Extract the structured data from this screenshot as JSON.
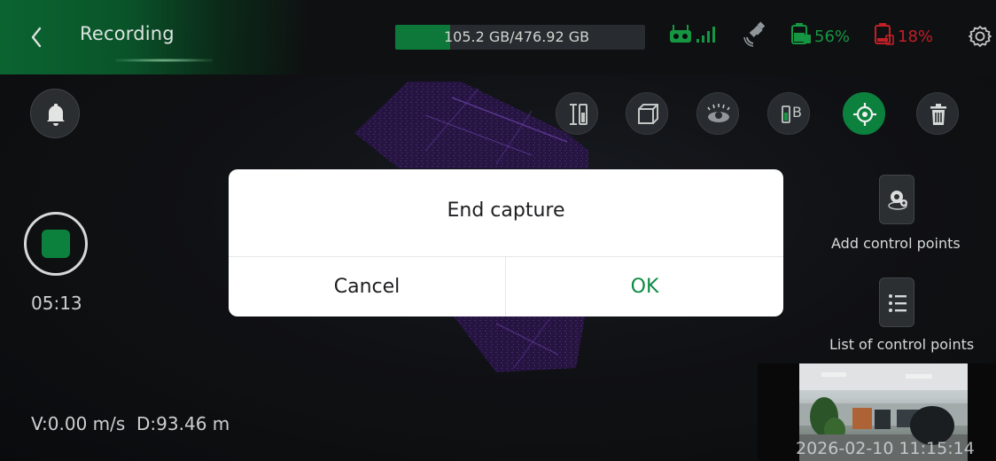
{
  "header": {
    "title": "Recording",
    "storage_text": "105.2 GB/476.92 GB",
    "storage_fraction": 0.22,
    "device_battery": "56%",
    "phone_battery": "18%"
  },
  "left": {
    "timer": "05:13",
    "speed_distance": "V:0.00 m/s  D:93.46 m"
  },
  "toolbar": {
    "b_label": "B"
  },
  "right_panel": {
    "add_control_points": "Add control points",
    "list_control_points": "List of control points"
  },
  "preview": {
    "timestamp": "2026-02-10 11:15:14"
  },
  "dialog": {
    "title": "End capture",
    "cancel": "Cancel",
    "ok": "OK"
  },
  "colors": {
    "accent": "#0d8a41",
    "warning": "#d0212a",
    "battery_green": "#16a34a"
  }
}
